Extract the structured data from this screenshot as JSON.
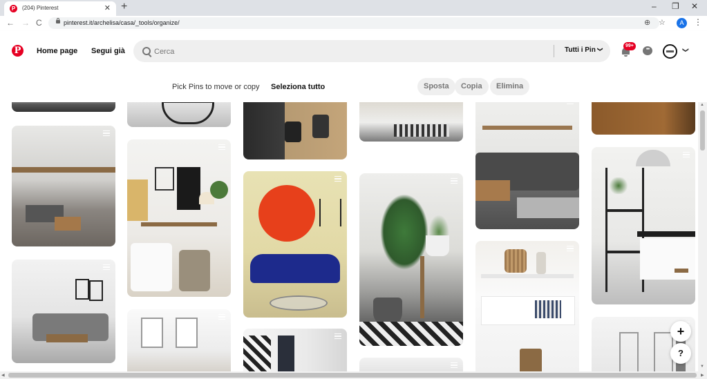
{
  "browser": {
    "tab_title": "(204) Pinterest",
    "tab_favicon": "P",
    "tab_close": "✕",
    "new_tab": "+",
    "window_controls": [
      "–",
      "❐",
      "✕"
    ],
    "url": "pinterest.it/archelisa/casa/_tools/organize/",
    "nav": [
      "←",
      "→",
      "C"
    ],
    "omnibox_icons": [
      "⊕",
      "☆"
    ],
    "profile_initial": "A",
    "menu": "⋮"
  },
  "header": {
    "logo": "P",
    "home_label": "Home page",
    "following_label": "Segui già",
    "search_placeholder": "Cerca",
    "scope_label": "Tutti i Pin",
    "scope_chevron": "❯",
    "notification_count": "99+",
    "messages_glyph": "•••",
    "account_chevron": "❯"
  },
  "organize": {
    "hint": "Pick Pins to move or copy",
    "select_all": "Seleziona tutto",
    "move": "Sposta",
    "copy": "Copia",
    "delete": "Elimina"
  },
  "floating": {
    "add": "+",
    "help": "?"
  },
  "scrollbars": {
    "up": "▲",
    "down": "▼",
    "left": "◀",
    "right": "▶"
  },
  "colors": {
    "brand": "#e60023",
    "pill_bg": "#efefef"
  }
}
